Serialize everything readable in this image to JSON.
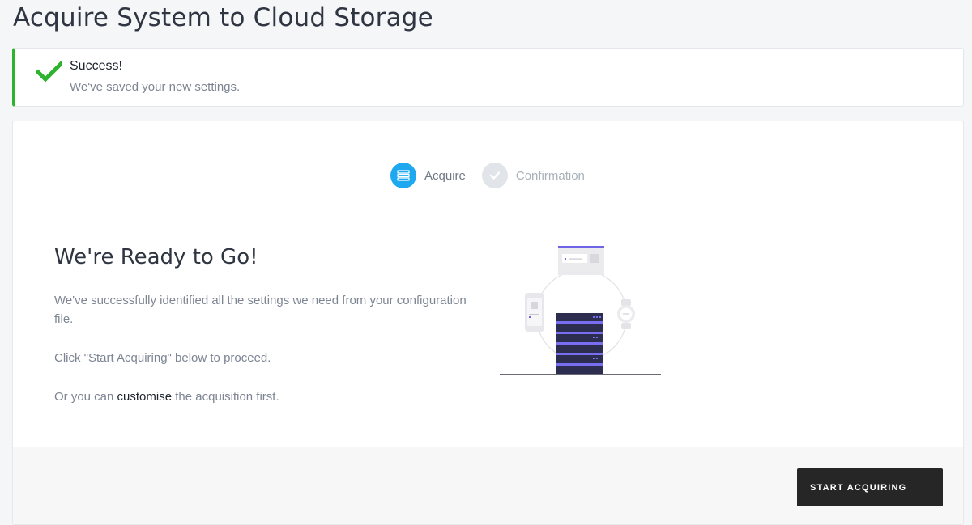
{
  "page": {
    "title": "Acquire System to Cloud Storage"
  },
  "alert": {
    "title": "Success!",
    "message": "We've saved your new settings.",
    "icon": "checkmark-icon",
    "accent_color": "#2db32d"
  },
  "steps": [
    {
      "label": "Acquire",
      "icon": "server-icon",
      "state": "active",
      "color": "#1ea8ef"
    },
    {
      "label": "Confirmation",
      "icon": "check-icon",
      "state": "inactive",
      "color": "#e1e4e8"
    }
  ],
  "main": {
    "heading": "We're Ready to Go!",
    "paragraph_1": "We've successfully identified all the settings we need from your configuration file.",
    "paragraph_2": "Click \"Start Acquiring\" below to proceed.",
    "paragraph_3_prefix": "Or you can ",
    "paragraph_3_link": "customise",
    "paragraph_3_suffix": " the acquisition first."
  },
  "footer": {
    "start_button_label": "START ACQUIRING"
  }
}
